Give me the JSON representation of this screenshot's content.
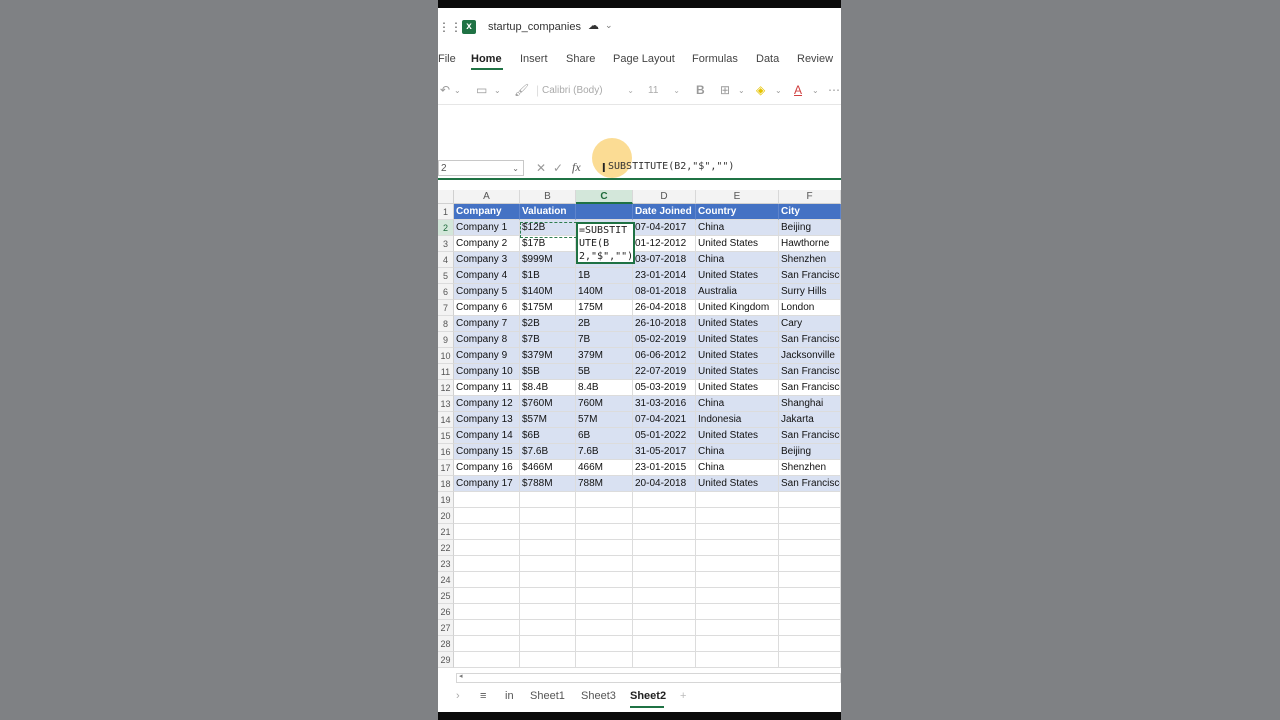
{
  "app": {
    "doc_title": "startup_companies",
    "accent_color": "#1f7244",
    "excel_icon_letter": "x"
  },
  "ribbon": {
    "tabs": [
      "File",
      "Home",
      "Insert",
      "Share",
      "Page Layout",
      "Formulas",
      "Data",
      "Review"
    ],
    "active_tab": "Home",
    "font_name": "Calibri (Body)",
    "font_size": "11",
    "bold_label": "B",
    "font_color_label": "A",
    "more_label": "⋯"
  },
  "formula_bar": {
    "name_box": "2",
    "fx_label": "fx",
    "formula_text": "SUBSTITUTE(B2,\"$\",\"\")"
  },
  "grid": {
    "columns": [
      "A",
      "B",
      "C",
      "D",
      "E",
      "F"
    ],
    "header_row": [
      "Company",
      "Valuation",
      "",
      "Date Joined",
      "Country",
      "City"
    ],
    "rows": [
      [
        "Company 1",
        "$12B",
        "",
        "07-04-2017",
        "China",
        "Beijing"
      ],
      [
        "Company 2",
        "$17B",
        "",
        "01-12-2012",
        "United States",
        "Hawthorne"
      ],
      [
        "Company 3",
        "$999M",
        "",
        "03-07-2018",
        "China",
        "Shenzhen"
      ],
      [
        "Company 4",
        "$1B",
        "1B",
        "23-01-2014",
        "United States",
        "San Francisco"
      ],
      [
        "Company 5",
        "$140M",
        "140M",
        "08-01-2018",
        "Australia",
        "Surry Hills"
      ],
      [
        "Company 6",
        "$175M",
        "175M",
        "26-04-2018",
        "United Kingdom",
        "London"
      ],
      [
        "Company 7",
        "$2B",
        "2B",
        "26-10-2018",
        "United States",
        "Cary"
      ],
      [
        "Company 8",
        "$7B",
        "7B",
        "05-02-2019",
        "United States",
        "San Francisco"
      ],
      [
        "Company 9",
        "$379M",
        "379M",
        "06-06-2012",
        "United States",
        "Jacksonville"
      ],
      [
        "Company 10",
        "$5B",
        "5B",
        "22-07-2019",
        "United States",
        "San Francisco"
      ],
      [
        "Company 11",
        "$8.4B",
        "8.4B",
        "05-03-2019",
        "United States",
        "San Francisco"
      ],
      [
        "Company 12",
        "$760M",
        "760M",
        "31-03-2016",
        "China",
        "Shanghai"
      ],
      [
        "Company 13",
        "$57M",
        "57M",
        "07-04-2021",
        "Indonesia",
        "Jakarta"
      ],
      [
        "Company 14",
        "$6B",
        "6B",
        "05-01-2022",
        "United States",
        "San Francisco"
      ],
      [
        "Company 15",
        "$7.6B",
        "7.6B",
        "31-05-2017",
        "China",
        "Beijing"
      ],
      [
        "Company 16",
        "$466M",
        "466M",
        "23-01-2015",
        "China",
        "Shenzhen"
      ],
      [
        "Company 17",
        "$788M",
        "788M",
        "20-04-2018",
        "United States",
        "San Francisco"
      ]
    ],
    "row_numbers": [
      "1",
      "2",
      "3",
      "4",
      "5",
      "6",
      "7",
      "8",
      "9",
      "10",
      "11",
      "12",
      "13",
      "14",
      "15",
      "16",
      "17",
      "18",
      "19",
      "20",
      "21",
      "22",
      "23",
      "24",
      "25",
      "26",
      "27",
      "28",
      "29"
    ],
    "edit_cell_text": "=SUBSTITUTE(B2,\"$\",\"\")",
    "header_color": "#4472c4",
    "band_color": "#d9e1f2"
  },
  "sheets": {
    "tabs": [
      "in",
      "Sheet1",
      "Sheet3",
      "Sheet2"
    ],
    "active": "Sheet2",
    "add_label": "+",
    "menu_label": "≡"
  }
}
